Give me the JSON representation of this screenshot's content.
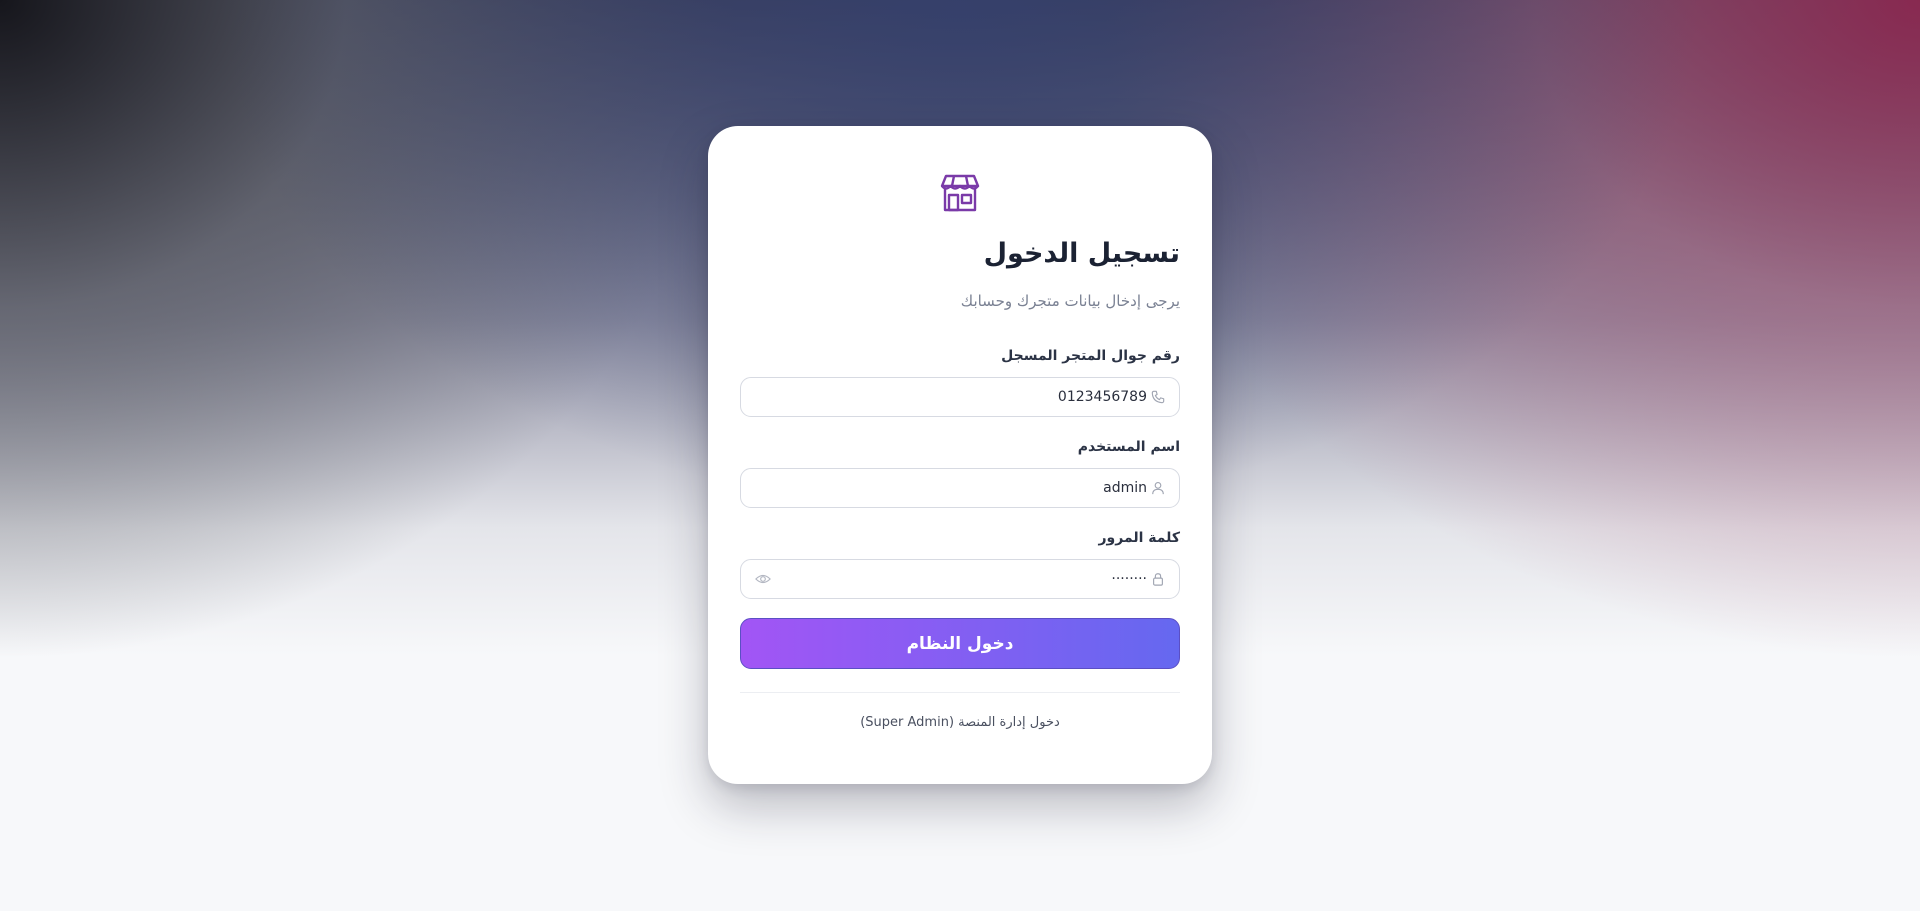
{
  "login": {
    "title": "تسجيل الدخول",
    "subtitle": "يرجى إدخال بيانات متجرك وحسابك",
    "phone": {
      "label": "رقم جوال المتجر المسجل",
      "value": "0123456789",
      "icon": "phone-icon"
    },
    "username": {
      "label": "اسم المستخدم",
      "value": "admin",
      "icon": "user-icon"
    },
    "password": {
      "label": "كلمة المرور",
      "value": "········",
      "icon": "lock-icon",
      "toggle_icon": "eye-icon"
    },
    "submit_label": "دخول النظام",
    "super_admin_link": "دخول إدارة المنصة (Super Admin)",
    "logo_icon": "store-icon"
  },
  "colors": {
    "accent_start": "#6568f0",
    "accent_end": "#a255f5",
    "logo": "#7a3aa8",
    "title": "#1b2233"
  }
}
